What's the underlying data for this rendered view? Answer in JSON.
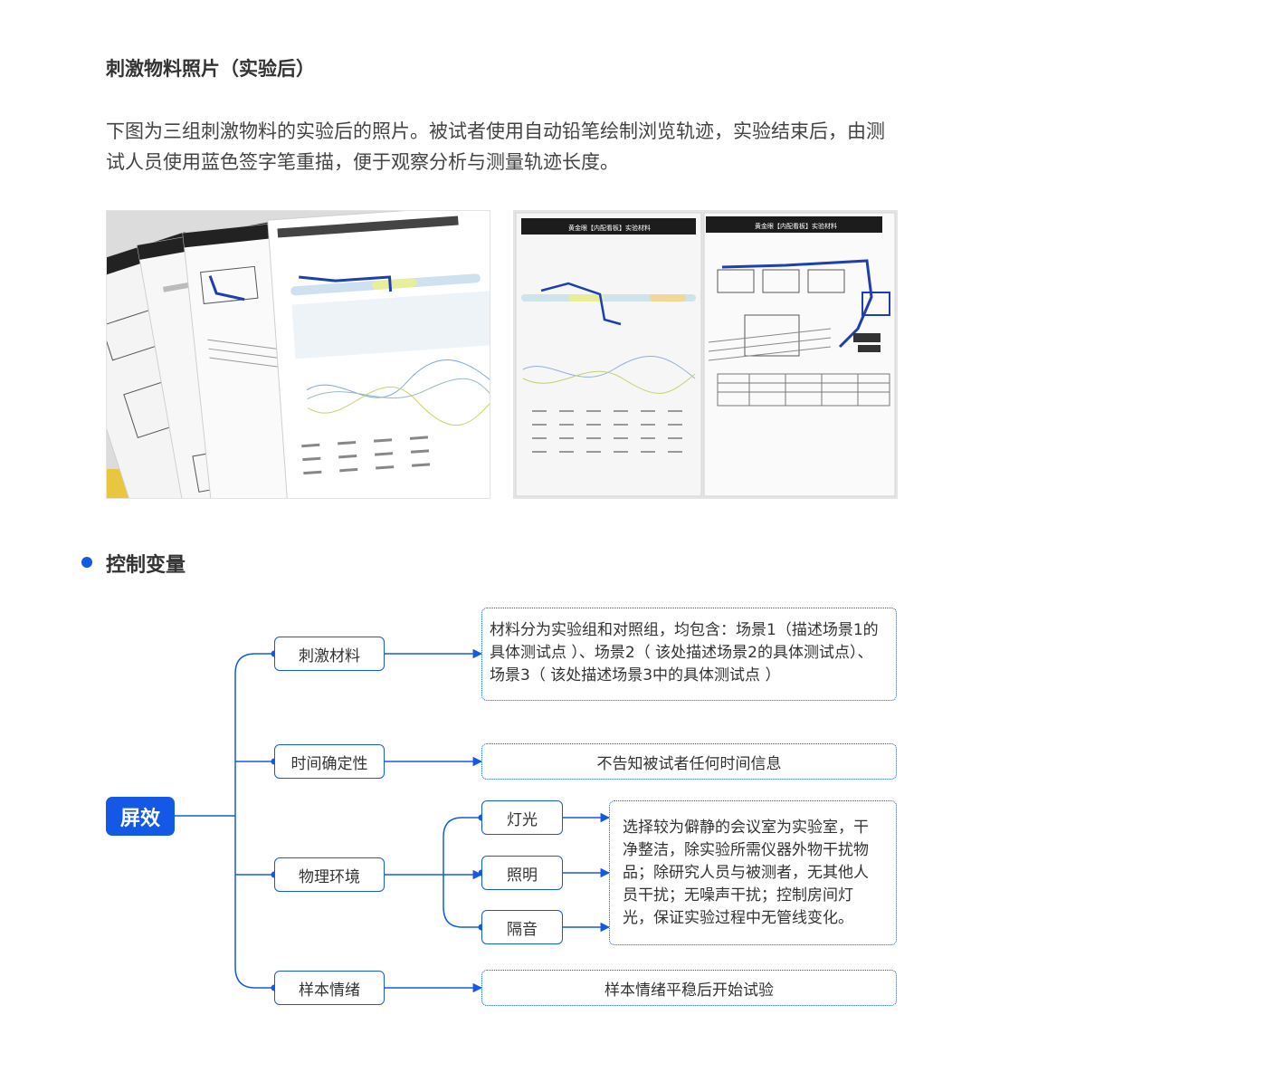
{
  "section1": {
    "title": "刺激物料照片（实验后）",
    "description": "下图为三组刺激物料的实验后的照片。被试者使用自动铅笔绘制浏览轨迹，实验结束后，由测试人员使用蓝色签字笔重描，便于观察分析与测量轨迹长度。"
  },
  "photos": [
    {
      "header": "黄金眼【内配看板】实验材料"
    },
    {
      "header": "黄金眼【内配看板】实验材料"
    }
  ],
  "section2": {
    "title": "控制变量"
  },
  "mindmap": {
    "root": "屏效",
    "branches": [
      {
        "label": "刺激材料",
        "note": "材料分为实验组和对照组，均包含：场景1（描述场景1的具体测试点 ）、场景2（ 该处描述场景2的具体测试点）、场景3（      该处描述场景3中的具体测试点        ）"
      },
      {
        "label": "时间确定性",
        "note": "不告知被试者任何时间信息"
      },
      {
        "label": "物理环境",
        "children": [
          "灯光",
          "照明",
          "隔音"
        ],
        "note": "选择较为僻静的会议室为实验室，干净整洁，除实验所需仪器外物干扰物品；除研究人员与被测者，无其他人员干扰；无噪声干扰；控制房间灯光，保证实验过程中无管线变化。"
      },
      {
        "label": "样本情绪",
        "note": "样本情绪平稳后开始试验"
      }
    ],
    "accent_color": "#1459e6"
  }
}
